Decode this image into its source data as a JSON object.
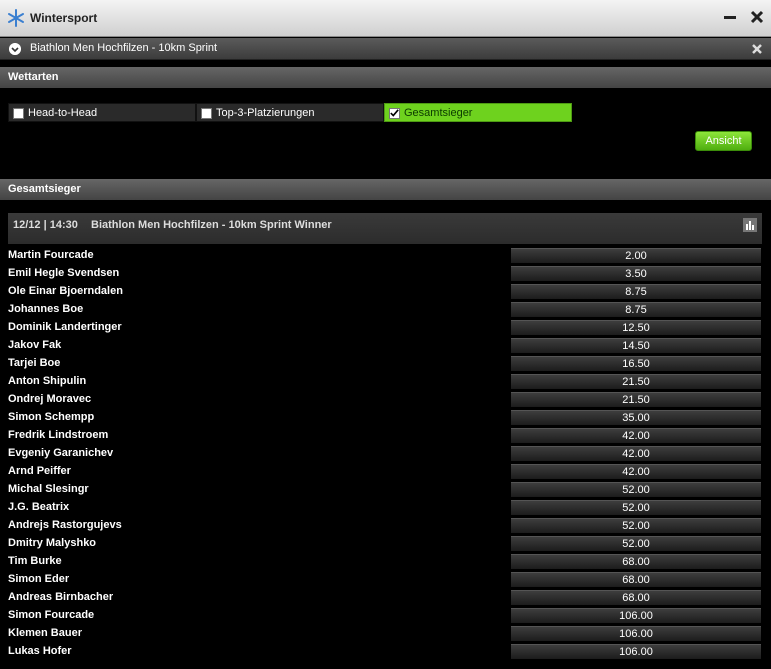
{
  "window": {
    "title": "Wintersport"
  },
  "event_header": {
    "title": "Biathlon Men Hochfilzen - 10km Sprint"
  },
  "bet_types": {
    "heading": "Wettarten",
    "tabs": [
      {
        "label": "Head-to-Head",
        "checked": false
      },
      {
        "label": "Top-3-Platzierungen",
        "checked": false
      },
      {
        "label": "Gesamtsieger",
        "checked": true
      }
    ],
    "view_button": "Ansicht"
  },
  "market": {
    "heading": "Gesamtsieger",
    "datetime": "12/12 | 14:30",
    "name": "Biathlon Men Hochfilzen - 10km Sprint Winner",
    "rows": [
      {
        "player": "Martin Fourcade",
        "odds": "2.00"
      },
      {
        "player": "Emil Hegle Svendsen",
        "odds": "3.50"
      },
      {
        "player": "Ole Einar Bjoerndalen",
        "odds": "8.75"
      },
      {
        "player": "Johannes Boe",
        "odds": "8.75"
      },
      {
        "player": "Dominik Landertinger",
        "odds": "12.50"
      },
      {
        "player": "Jakov Fak",
        "odds": "14.50"
      },
      {
        "player": "Tarjei Boe",
        "odds": "16.50"
      },
      {
        "player": "Anton Shipulin",
        "odds": "21.50"
      },
      {
        "player": "Ondrej Moravec",
        "odds": "21.50"
      },
      {
        "player": "Simon Schempp",
        "odds": "35.00"
      },
      {
        "player": "Fredrik Lindstroem",
        "odds": "42.00"
      },
      {
        "player": "Evgeniy Garanichev",
        "odds": "42.00"
      },
      {
        "player": "Arnd Peiffer",
        "odds": "42.00"
      },
      {
        "player": "Michal Slesingr",
        "odds": "52.00"
      },
      {
        "player": "J.G. Beatrix",
        "odds": "52.00"
      },
      {
        "player": "Andrejs Rastorgujevs",
        "odds": "52.00"
      },
      {
        "player": "Dmitry Malyshko",
        "odds": "52.00"
      },
      {
        "player": "Tim Burke",
        "odds": "68.00"
      },
      {
        "player": "Simon Eder",
        "odds": "68.00"
      },
      {
        "player": "Andreas Birnbacher",
        "odds": "68.00"
      },
      {
        "player": "Simon Fourcade",
        "odds": "106.00"
      },
      {
        "player": "Klemen Bauer",
        "odds": "106.00"
      },
      {
        "player": "Lukas Hofer",
        "odds": "106.00"
      }
    ]
  },
  "colors": {
    "accent": "#6ed21e",
    "background": "#000000"
  },
  "icons": [
    "snowflake-icon",
    "minimize-icon",
    "close-icon",
    "chevron-down-icon",
    "remove-icon",
    "stats-icon",
    "checkbox-icon"
  ]
}
